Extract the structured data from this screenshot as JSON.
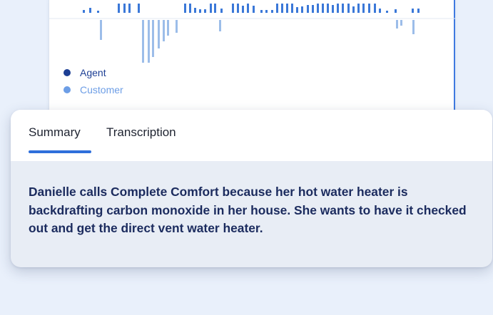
{
  "legend": {
    "agent_label": "Agent",
    "customer_label": "Customer",
    "agent_color": "#1d3f94",
    "customer_color": "#6d9ee6"
  },
  "waveform": {
    "agent_bar_color": "#3b78d8",
    "customer_bar_color": "#9cbde9",
    "baseline_color": "#e3e8f0"
  },
  "tabs": {
    "items": [
      {
        "label": "Summary",
        "active": true
      },
      {
        "label": "Transcription",
        "active": false
      }
    ],
    "accent_color": "#2f6fdb"
  },
  "summary": {
    "text": "Danielle calls Complete Comfort because her hot water heater is backdrafting carbon monoxide in her house. She wants to have it checked out and get the direct vent water heater.",
    "text_color": "#1b2b5e"
  }
}
